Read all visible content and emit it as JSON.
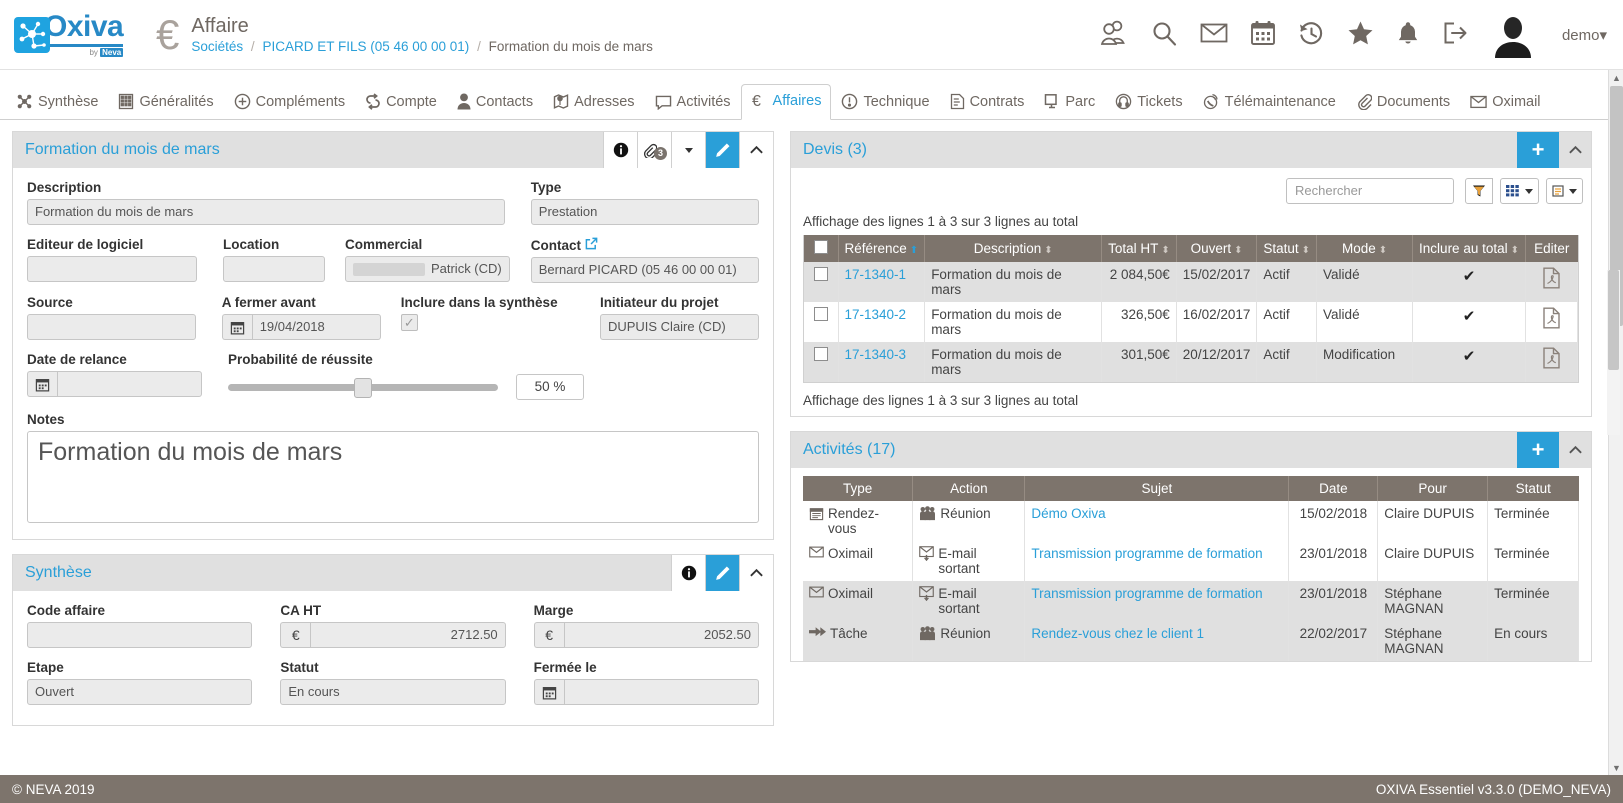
{
  "header": {
    "brand": "Oxiva",
    "brand_by": "by Neva",
    "app_title": "Affaire",
    "breadcrumb": {
      "root": "Sociétés",
      "company": "PICARD ET FILS (05 46 00 00 01)",
      "current": "Formation du mois de mars",
      "separator": "/"
    },
    "icons": [
      "users-icon",
      "search-icon",
      "mail-icon",
      "calendar-icon",
      "history-icon",
      "star-icon",
      "bell-icon",
      "logout-icon"
    ],
    "user": "demo"
  },
  "nav": {
    "tabs": [
      {
        "label": "Synthèse",
        "icon": "synthesis-icon",
        "active": false
      },
      {
        "label": "Généralités",
        "icon": "building-icon",
        "active": false
      },
      {
        "label": "Compléments",
        "icon": "plus-circle-icon",
        "active": false
      },
      {
        "label": "Compte",
        "icon": "exchange-icon",
        "active": false
      },
      {
        "label": "Contacts",
        "icon": "person-icon",
        "active": false
      },
      {
        "label": "Adresses",
        "icon": "map-pin-icon",
        "active": false
      },
      {
        "label": "Activités",
        "icon": "speech-bubble-icon",
        "active": false
      },
      {
        "label": "Affaires",
        "icon": "euro-icon",
        "active": true
      },
      {
        "label": "Technique",
        "icon": "exclamation-circle-icon",
        "active": false
      },
      {
        "label": "Contrats",
        "icon": "contract-icon",
        "active": false
      },
      {
        "label": "Parc",
        "icon": "monitor-icon",
        "active": false
      },
      {
        "label": "Tickets",
        "icon": "headset-icon",
        "active": false
      },
      {
        "label": "Télémaintenance",
        "icon": "remote-support-icon",
        "active": false
      },
      {
        "label": "Documents",
        "icon": "paperclip-icon",
        "active": false
      },
      {
        "label": "Oximail",
        "icon": "envelope-icon",
        "active": false
      }
    ]
  },
  "affaire_panel": {
    "title": "Formation du mois de mars",
    "attachment_count": "3",
    "buttons": {
      "info": "info-icon",
      "attach": "paperclip-icon",
      "dropdown": "caret-down-icon",
      "edit": "pencil-icon",
      "collapse": "chevron-up-icon"
    },
    "fields": {
      "description_label": "Description",
      "description_value": "Formation du mois de mars",
      "type_label": "Type",
      "type_value": "Prestation",
      "editeur_label": "Editeur de logiciel",
      "editeur_value": "",
      "location_label": "Location",
      "location_value": "",
      "commercial_label": "Commercial",
      "commercial_value": "Patrick (CD)",
      "contact_label": "Contact",
      "contact_value": "Bernard PICARD (05 46 00 00 01)",
      "source_label": "Source",
      "source_value": "",
      "afermer_label": "A fermer avant",
      "afermer_value": "19/04/2018",
      "inclure_label": "Inclure dans la synthèse",
      "inclure_checked": true,
      "initiateur_label": "Initiateur du projet",
      "initiateur_value": "DUPUIS Claire (CD)",
      "relance_label": "Date de relance",
      "relance_value": "",
      "proba_label": "Probabilité de réussite",
      "proba_value": "50 %",
      "proba_percent": 50,
      "notes_label": "Notes",
      "notes_value": "Formation du mois de mars"
    }
  },
  "synthese_panel": {
    "title": "Synthèse",
    "buttons": {
      "info": "info-icon",
      "edit": "pencil-icon",
      "collapse": "chevron-up-icon"
    },
    "fields": {
      "code_label": "Code affaire",
      "code_value": "",
      "caht_label": "CA HT",
      "caht_value": "2712.50",
      "caht_currency": "€",
      "marge_label": "Marge",
      "marge_value": "2052.50",
      "marge_currency": "€",
      "etape_label": "Etape",
      "etape_value": "Ouvert",
      "statut_label": "Statut",
      "statut_value": "En cours",
      "fermee_label": "Fermée le",
      "fermee_value": ""
    }
  },
  "devis_panel": {
    "title": "Devis (3)",
    "add_label": "+",
    "collapse": "chevron-up-icon",
    "search_placeholder": "Rechercher",
    "search_value": "",
    "toolbar_icons": [
      "filter-icon",
      "columns-icon",
      "caret-down-icon",
      "export-icon",
      "caret-down-icon"
    ],
    "rowinfo_top": "Affichage des lignes 1 à 3 sur 3 lignes au total",
    "rowinfo_bottom": "Affichage des lignes 1 à 3 sur 3 lignes au total",
    "columns": [
      "",
      "Référence",
      "Description",
      "Total HT",
      "Ouvert",
      "Statut",
      "Mode",
      "Inclure au total",
      "Editer"
    ],
    "rows": [
      {
        "reference": "17-1340-1",
        "description": "Formation du mois de mars",
        "total_ht": "2 084,50€",
        "ouvert": "15/02/2017",
        "statut": "Actif",
        "mode": "Validé",
        "inclure": "✔",
        "editer": "pdf-icon"
      },
      {
        "reference": "17-1340-2",
        "description": "Formation du mois de mars",
        "total_ht": "326,50€",
        "ouvert": "16/02/2017",
        "statut": "Actif",
        "mode": "Validé",
        "inclure": "✔",
        "editer": "pdf-icon"
      },
      {
        "reference": "17-1340-3",
        "description": "Formation du mois de mars",
        "total_ht": "301,50€",
        "ouvert": "20/12/2017",
        "statut": "Actif",
        "mode": "Modification",
        "inclure": "✔",
        "editer": "pdf-icon"
      }
    ]
  },
  "activites_panel": {
    "title": "Activités (17)",
    "add_label": "+",
    "collapse": "chevron-up-icon",
    "columns": [
      "Type",
      "Action",
      "Sujet",
      "Date",
      "Pour",
      "Statut"
    ],
    "rows": [
      {
        "type": "Rendez-vous",
        "type_icon": "appointment-icon",
        "action": "Réunion",
        "action_icon": "group-icon",
        "sujet": "Démo Oxiva",
        "date": "15/02/2018",
        "pour": "Claire DUPUIS",
        "statut": "Terminée"
      },
      {
        "type": "Oximail",
        "type_icon": "envelope-icon",
        "action": "E-mail sortant",
        "action_icon": "outgoing-mail-icon",
        "sujet": "Transmission programme de formation",
        "date": "23/01/2018",
        "pour": "Claire DUPUIS",
        "statut": "Terminée"
      },
      {
        "type": "Oximail",
        "type_icon": "envelope-icon",
        "action": "E-mail sortant",
        "action_icon": "outgoing-mail-icon",
        "sujet": "Transmission programme de formation",
        "date": "23/01/2018",
        "pour": "Stéphane MAGNAN",
        "statut": "Terminée"
      },
      {
        "type": "Tâche",
        "type_icon": "task-arrow-icon",
        "action": "Réunion",
        "action_icon": "group-icon",
        "sujet": "Rendez-vous chez le client 1",
        "date": "22/02/2017",
        "pour": "Stéphane MAGNAN",
        "statut": "En cours"
      }
    ]
  },
  "footer": {
    "left": "© NEVA 2019",
    "right": "OXIVA Essentiel v3.3.0 (DEMO_NEVA)"
  },
  "colors": {
    "accent": "#2a9fd8",
    "header_gray": "#7d746c",
    "panel_head": "#e0e0e0"
  }
}
